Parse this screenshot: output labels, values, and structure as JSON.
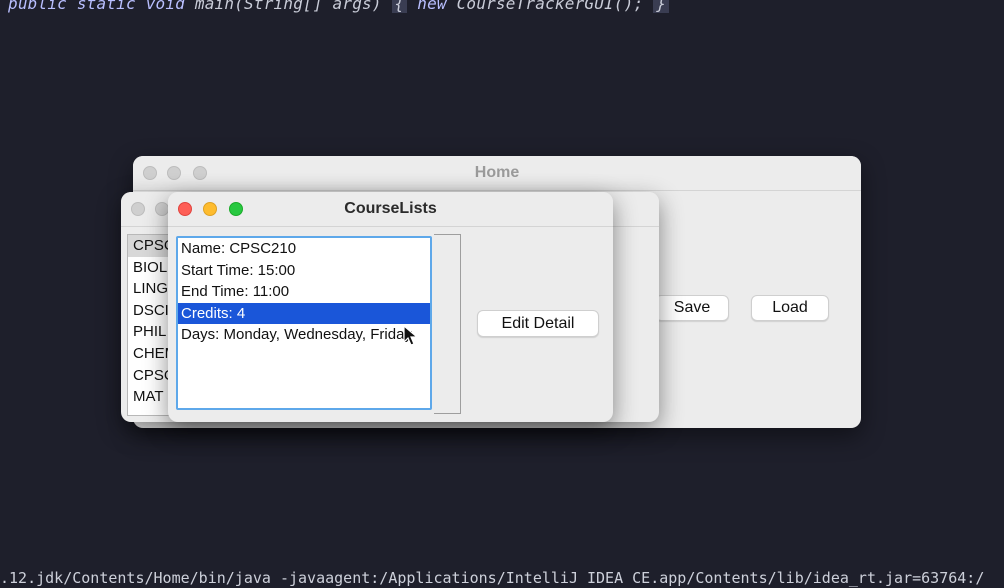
{
  "editor": {
    "kw_public": "public",
    "kw_static": "static",
    "kw_void": "void",
    "main_sig": "main(String[] args)",
    "brace_open": "{",
    "kw_new": "new",
    "call": "CourseTrackerGUI();",
    "brace_close": "}"
  },
  "console": {
    "command": ".12.jdk/Contents/Home/bin/java -javaagent:/Applications/IntelliJ IDEA CE.app/Contents/lib/idea_rt.jar=63764:/"
  },
  "home_window": {
    "title": "Home",
    "save_label": "Save",
    "load_label": "Load"
  },
  "courses_window": {
    "items": [
      "CPSC",
      "BIOL",
      "LING",
      "DSCI",
      "PHIL",
      "CHEM",
      "CPSC",
      "MAT"
    ]
  },
  "courselists_window": {
    "title": "CourseLists",
    "details": [
      "Name: CPSC210",
      "Start Time: 15:00",
      "End Time: 11:00",
      "Credits: 4",
      "Days: Monday, Wednesday, Friday"
    ],
    "selected_index": 3,
    "edit_label": "Edit Detail"
  },
  "icons": {
    "refresh": "refresh-icon",
    "cursor": "mouse-pointer-icon"
  },
  "colors": {
    "selection": "#1a56d9",
    "focus_ring": "#5ea8ea"
  }
}
